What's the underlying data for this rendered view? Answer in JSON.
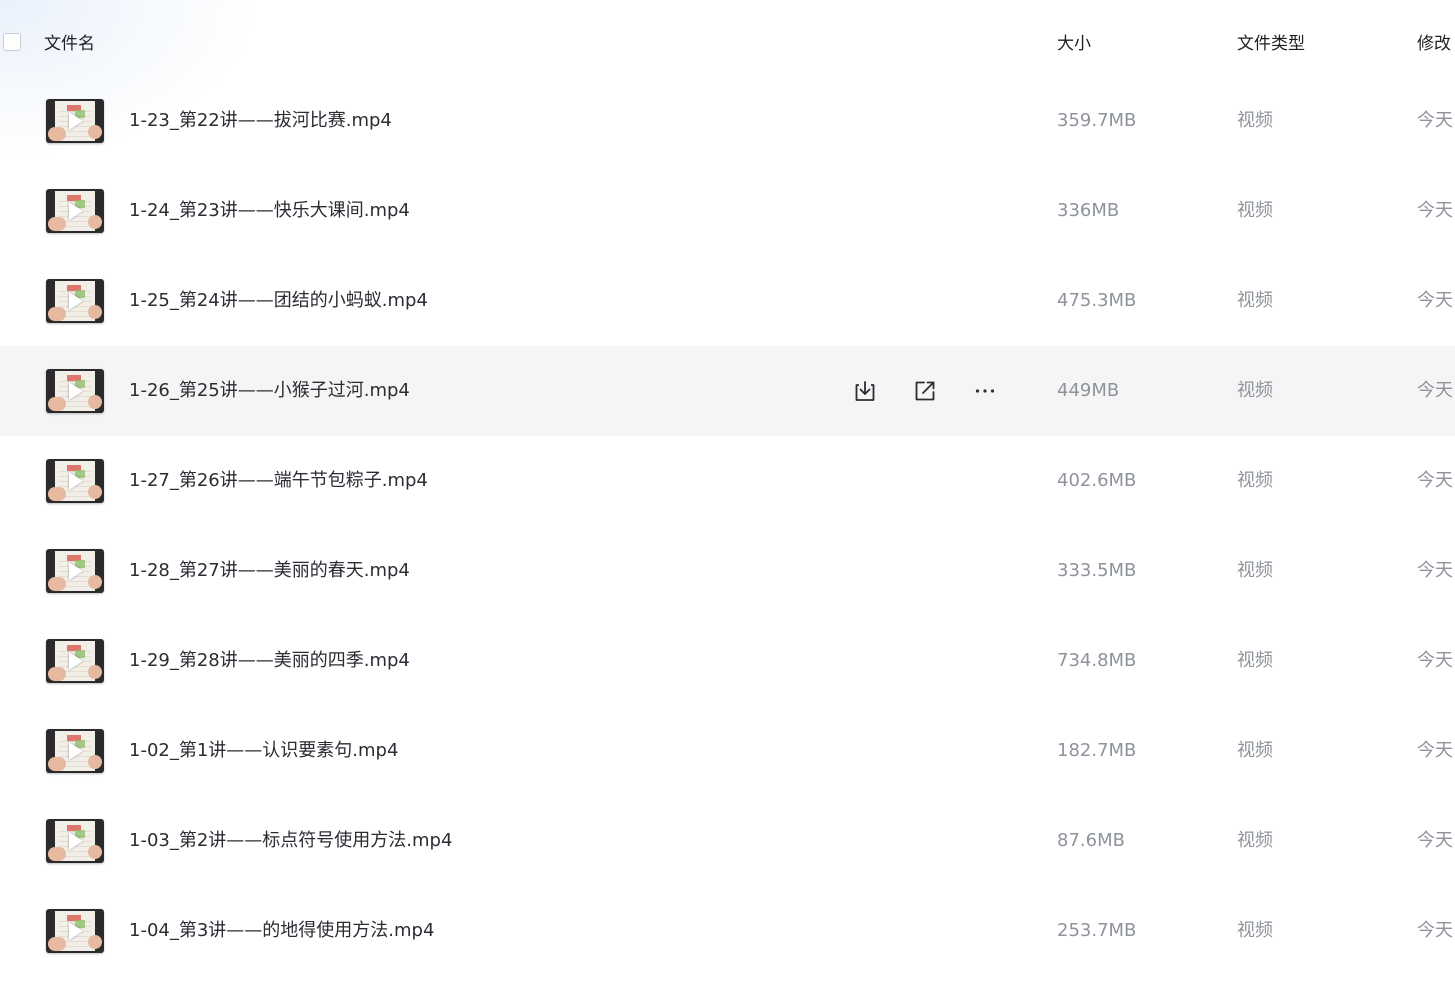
{
  "header": {
    "name": "文件名",
    "size": "大小",
    "type": "文件类型",
    "modified": "修改"
  },
  "rows": [
    {
      "name": "1-23_第22讲——拔河比赛.mp4",
      "size": "359.7MB",
      "type": "视频",
      "modified": "今天"
    },
    {
      "name": "1-24_第23讲——快乐大课间.mp4",
      "size": "336MB",
      "type": "视频",
      "modified": "今天"
    },
    {
      "name": "1-25_第24讲——团结的小蚂蚁.mp4",
      "size": "475.3MB",
      "type": "视频",
      "modified": "今天"
    },
    {
      "name": "1-26_第25讲——小猴子过河.mp4",
      "size": "449MB",
      "type": "视频",
      "modified": "今天"
    },
    {
      "name": "1-27_第26讲——端午节包粽子.mp4",
      "size": "402.6MB",
      "type": "视频",
      "modified": "今天"
    },
    {
      "name": "1-28_第27讲——美丽的春天.mp4",
      "size": "333.5MB",
      "type": "视频",
      "modified": "今天"
    },
    {
      "name": "1-29_第28讲——美丽的四季.mp4",
      "size": "734.8MB",
      "type": "视频",
      "modified": "今天"
    },
    {
      "name": "1-02_第1讲——认识要素句.mp4",
      "size": "182.7MB",
      "type": "视频",
      "modified": "今天"
    },
    {
      "name": "1-03_第2讲——标点符号使用方法.mp4",
      "size": "87.6MB",
      "type": "视频",
      "modified": "今天"
    },
    {
      "name": "1-04_第3讲——的地得使用方法.mp4",
      "size": "253.7MB",
      "type": "视频",
      "modified": "今天"
    }
  ],
  "icons": {
    "thumbnail": "video-thumbnail-icon",
    "play": "play-icon",
    "download": "download-icon",
    "share": "share-icon",
    "more": "more-icon"
  },
  "colors": {
    "hover_row": "#f5f5f6",
    "name_text": "#2a2d33",
    "meta_text": "#8e939c"
  }
}
